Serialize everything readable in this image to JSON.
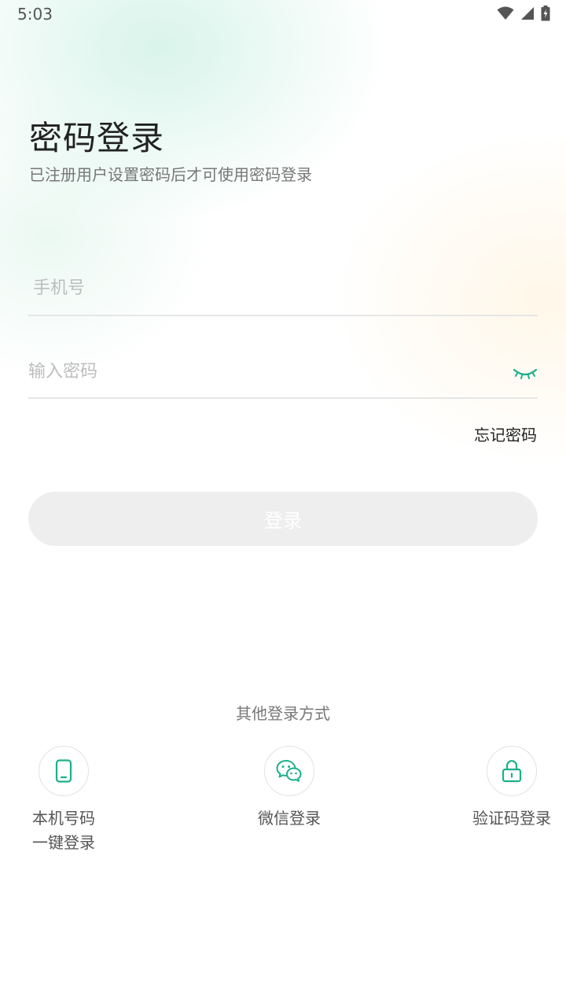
{
  "status_bar": {
    "time": "5:03",
    "icons": [
      "wifi-icon",
      "cellular-signal-icon",
      "battery-charging-icon"
    ]
  },
  "header": {
    "title": "密码登录",
    "subtitle": "已注册用户设置密码后才可使用密码登录"
  },
  "form": {
    "phone_placeholder": "手机号",
    "phone_value": "",
    "password_placeholder": "输入密码",
    "password_value": "",
    "password_toggle_icon": "eye-closed-icon",
    "forgot_label": "忘记密码",
    "login_label": "登录"
  },
  "other_login": {
    "title": "其他登录方式",
    "options": [
      {
        "label": "本机号码\n一键登录",
        "icon": "phone-icon"
      },
      {
        "label": "微信登录",
        "icon": "wechat-icon"
      },
      {
        "label": "验证码登录",
        "icon": "lock-icon"
      }
    ]
  },
  "colors": {
    "accent": "#1bb08a",
    "button_disabled_bg": "#eeeeee",
    "title_text": "#222222",
    "placeholder_text": "#bdbdbd"
  }
}
